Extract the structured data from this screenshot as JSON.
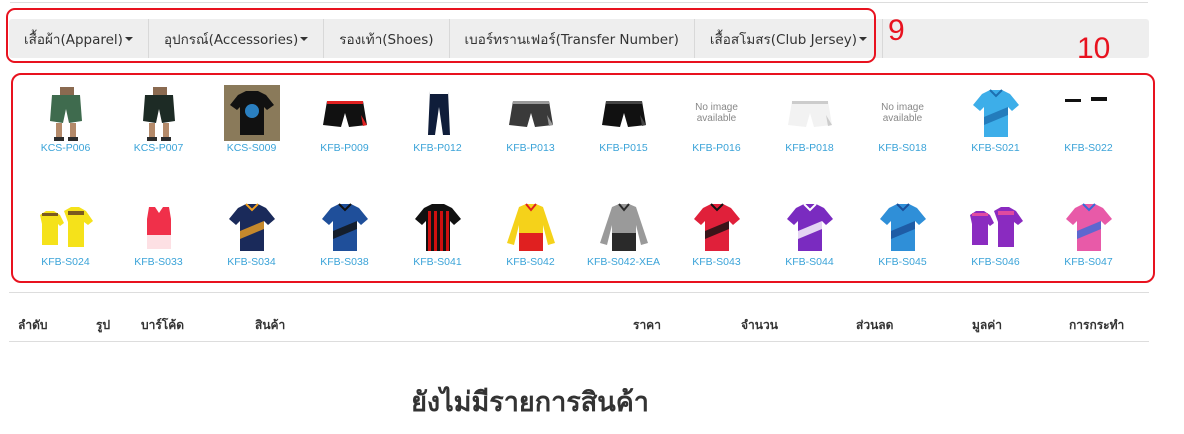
{
  "categories": [
    {
      "label": "เสื้อผ้า(Apparel)",
      "dropdown": true
    },
    {
      "label": "อุปกรณ์(Accessories)",
      "dropdown": true
    },
    {
      "label": "รองเท้า(Shoes)",
      "dropdown": false
    },
    {
      "label": "เบอร์ทรานเฟอร์(Transfer Number)",
      "dropdown": false
    },
    {
      "label": "เสื้อสโมสร(Club Jersey)",
      "dropdown": true
    }
  ],
  "annotations": {
    "tabs_marker": "9",
    "grid_marker": "10"
  },
  "annotation_color": "#e8121f",
  "link_color": "#3aa3d8",
  "no_image_text": "No image available",
  "products": [
    {
      "code": "KCS-P006",
      "kind": "shorts-model",
      "c1": "#3f6b4e",
      "c2": "#2c2c2c"
    },
    {
      "code": "KCS-P007",
      "kind": "shorts-model",
      "c1": "#1d2b25",
      "c2": "#2c2c2c"
    },
    {
      "code": "KCS-S009",
      "kind": "photo-shirt",
      "c1": "#111111",
      "c2": "#2a7fc0"
    },
    {
      "code": "KFB-P009",
      "kind": "shorts",
      "c1": "#111111",
      "c2": "#e02020"
    },
    {
      "code": "KFB-P012",
      "kind": "pants",
      "c1": "#0f1d3a",
      "c2": "#ffffff"
    },
    {
      "code": "KFB-P013",
      "kind": "shorts",
      "c1": "#3a3a3a",
      "c2": "#9a9a9a"
    },
    {
      "code": "KFB-P015",
      "kind": "shorts",
      "c1": "#111111",
      "c2": "#444444"
    },
    {
      "code": "KFB-P016",
      "kind": "noimage"
    },
    {
      "code": "KFB-P018",
      "kind": "shorts",
      "c1": "#f2f2f2",
      "c2": "#cccccc"
    },
    {
      "code": "KFB-S018",
      "kind": "noimage"
    },
    {
      "code": "KFB-S021",
      "kind": "shirt",
      "c1": "#3daee9",
      "c2": "#1d6fb0"
    },
    {
      "code": "KFB-S022",
      "kind": "shirt-pair",
      "c1": "#ffffff",
      "c2": "#111111"
    },
    {
      "code": "KFB-S024",
      "kind": "shirt-pair",
      "c1": "#f5e21a",
      "c2": "#7a5a20"
    },
    {
      "code": "KFB-S033",
      "kind": "vest",
      "c1": "#f0304a",
      "c2": "#ffffff"
    },
    {
      "code": "KFB-S034",
      "kind": "shirt",
      "c1": "#1a2a5a",
      "c2": "#f0a020"
    },
    {
      "code": "KFB-S038",
      "kind": "shirt",
      "c1": "#1f4f9a",
      "c2": "#111111"
    },
    {
      "code": "KFB-S041",
      "kind": "shirt-stripes",
      "c1": "#d01010",
      "c2": "#111111"
    },
    {
      "code": "KFB-S042",
      "kind": "longsleeve",
      "c1": "#f5d21a",
      "c2": "#e02020"
    },
    {
      "code": "KFB-S042-XEA",
      "kind": "longsleeve",
      "c1": "#9a9a9a",
      "c2": "#2a2a2a"
    },
    {
      "code": "KFB-S043",
      "kind": "shirt",
      "c1": "#e0203a",
      "c2": "#111111"
    },
    {
      "code": "KFB-S044",
      "kind": "shirt",
      "c1": "#7a2bc0",
      "c2": "#ffffff"
    },
    {
      "code": "KFB-S045",
      "kind": "shirt",
      "c1": "#2f8fd8",
      "c2": "#1a4f9a"
    },
    {
      "code": "KFB-S046",
      "kind": "shirt-pair",
      "c1": "#8a2bc0",
      "c2": "#e04aa0"
    },
    {
      "code": "KFB-S047",
      "kind": "shirt",
      "c1": "#e85aa8",
      "c2": "#3a6ad8"
    }
  ],
  "table": {
    "columns": {
      "seq": "ลำดับ",
      "image": "รูป",
      "barcode": "บาร์โค้ด",
      "product": "สินค้า",
      "price": "ราคา",
      "qty": "จำนวน",
      "discount": "ส่วนลด",
      "value": "มูลค่า",
      "action": "การกระทำ"
    }
  },
  "empty_message": "ยังไม่มีรายการสินค้า"
}
